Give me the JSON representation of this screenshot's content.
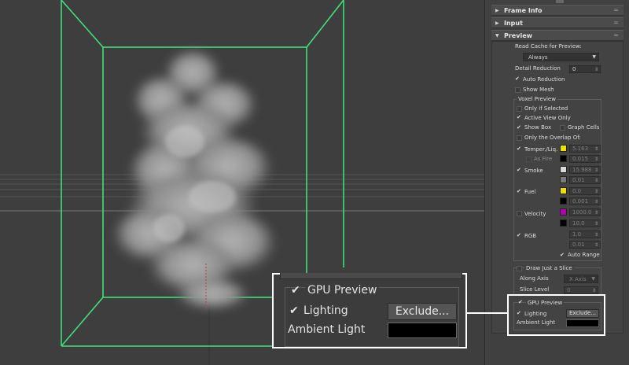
{
  "panel": {
    "rollouts": {
      "frame_info": "Frame Info",
      "input": "Input",
      "preview": "Preview"
    },
    "read_cache_label": "Read Cache for Preview:",
    "read_cache_value": "Always",
    "detail_reduction_label": "Detail Reduction",
    "detail_reduction_value": "0",
    "auto_reduction": "Auto Reduction",
    "show_mesh": "Show Mesh",
    "voxel_preview": {
      "title": "Voxel Preview",
      "only_if_selected": "Only if Selected",
      "active_view_only": "Active View Only",
      "show_box": "Show Box",
      "graph_cells": "Graph Cells",
      "only_overlap": "Only the Overlap Of:",
      "temper": "Temper./Liq.",
      "temper_value": "5.163",
      "as_fire": "As Fire",
      "as_fire_value": "0.015",
      "smoke": "Smoke",
      "smoke_value": "15.988",
      "smoke_value2": "0.01",
      "fuel": "Fuel",
      "fuel_value": "0.0",
      "fuel_value2": "0.001",
      "velocity": "Velocity",
      "velocity_value": "1000.0",
      "velocity_value2": "10.0",
      "rgb": "RGB",
      "rgb_value": "1.0",
      "rgb_value2": "0.01",
      "auto_range": "Auto Range"
    },
    "slice": {
      "title": "Draw Just a Slice",
      "along_axis_label": "Along Axis",
      "along_axis_value": "X Axis",
      "slice_level_label": "Slice Level",
      "slice_level_value": "0"
    },
    "gpu": {
      "gpu_preview": "GPU Preview",
      "lighting": "Lighting",
      "exclude": "Exclude...",
      "ambient_light": "Ambient Light"
    }
  },
  "zoom": {
    "gpu_preview": "GPU Preview",
    "lighting": "Lighting",
    "exclude": "Exclude...",
    "ambient_light": "Ambient Light"
  },
  "colors": {
    "box_green": "#3ee07a",
    "temper_swatch": "#f0e000",
    "smoke_swatch": "#d8d8d8",
    "fuel_swatch": "#f0e000",
    "velocity_swatch": "#b000b0",
    "ambient": "#000000"
  }
}
